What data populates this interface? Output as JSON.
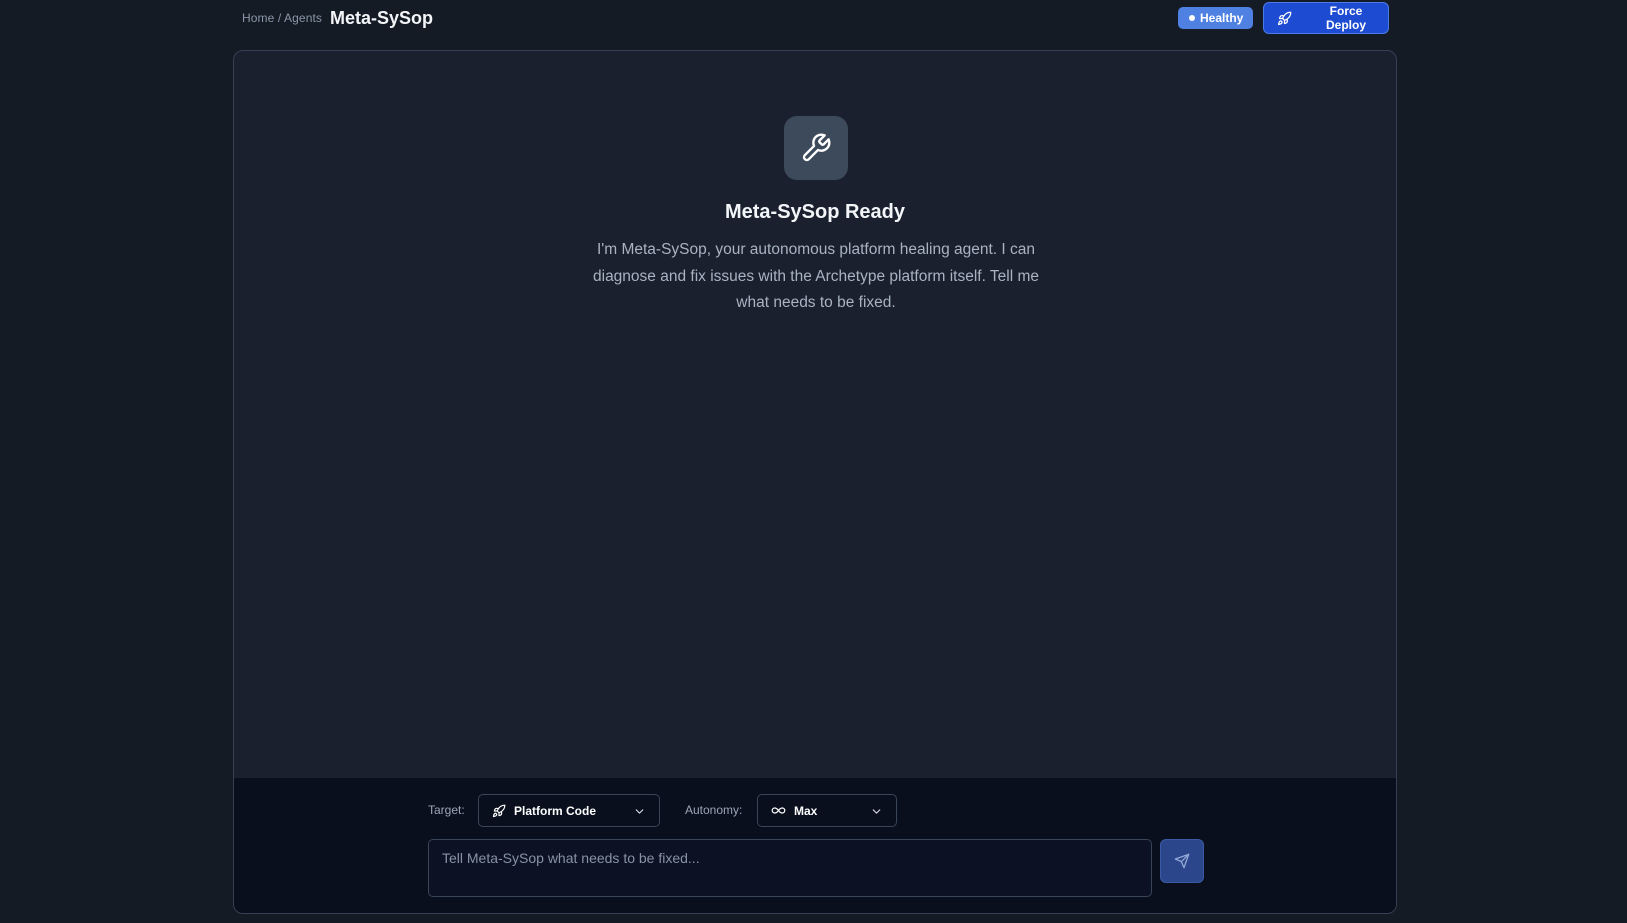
{
  "header": {
    "breadcrumb": "Home / Agents",
    "title": "Meta-SySop",
    "status_badge": "Healthy",
    "deploy_button": "Force Deploy"
  },
  "empty_state": {
    "icon": "wrench-icon",
    "title": "Meta-SySop Ready",
    "description": "I'm Meta-SySop, your autonomous platform healing agent. I can diagnose and fix issues with the Archetype platform itself. Tell me what needs to be fixed."
  },
  "composer": {
    "target_label": "Target:",
    "target_value": "Platform Code",
    "autonomy_label": "Autonomy:",
    "autonomy_value": "Max",
    "input_placeholder": "Tell Meta-SySop what needs to be fixed..."
  },
  "colors": {
    "background": "#151b25",
    "panel": "#1a202d",
    "composer": "#0a0f1d",
    "accent": "#1d4bd1",
    "healthy": "#4f81e3"
  }
}
